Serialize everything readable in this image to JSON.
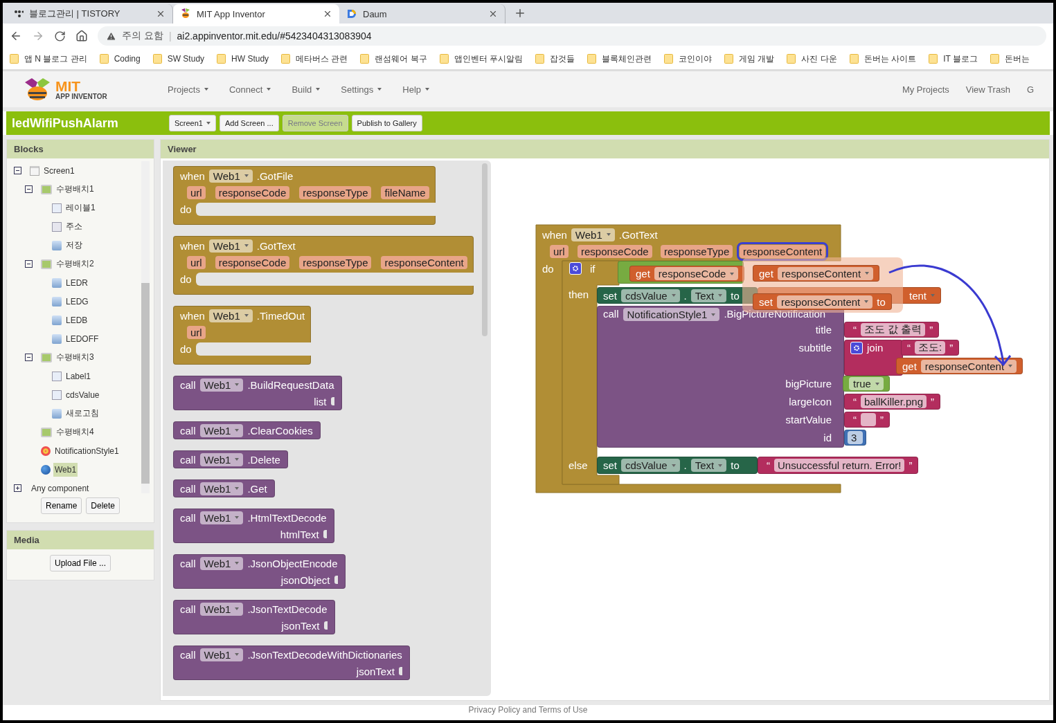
{
  "browser": {
    "tabs": [
      {
        "title": "블로그관리 | TISTORY",
        "selected": false
      },
      {
        "title": "MIT App Inventor",
        "selected": true
      },
      {
        "title": "Daum",
        "selected": false
      }
    ],
    "address": {
      "warning": "주의 요함",
      "separator": "|",
      "url": "ai2.appinventor.mit.edu/#5423404313083904"
    },
    "bookmarks": [
      "앱 N 블로그 관리",
      "Coding",
      "SW Study",
      "HW Study",
      "메타버스 관련",
      "랜섬웨어 복구",
      "앱인벤터 푸시알림",
      "잡것들",
      "블록체인관련",
      "코인이야",
      "게임 개발",
      "사진 다운",
      "돈버는 사이트",
      "IT 블로그",
      "돈버는"
    ]
  },
  "app_header": {
    "logo": {
      "line1": "MIT",
      "line2": "APP INVENTOR"
    },
    "menu": [
      "Projects",
      "Connect",
      "Build",
      "Settings",
      "Help"
    ],
    "links": [
      "My Projects",
      "View Trash",
      "G"
    ]
  },
  "project_bar": {
    "title": "ledWifiPushAlarm",
    "buttons": [
      {
        "label": "Screen1",
        "dropdown": true,
        "disabled": false
      },
      {
        "label": "Add Screen ...",
        "dropdown": false,
        "disabled": false
      },
      {
        "label": "Remove Screen",
        "dropdown": false,
        "disabled": true
      },
      {
        "label": "Publish to Gallery",
        "dropdown": false,
        "disabled": false
      }
    ]
  },
  "blocks_panel": {
    "title": "Blocks",
    "tree": [
      {
        "label": "Screen1",
        "kind": "screen",
        "expanded": true,
        "selected": false,
        "children": [
          {
            "label": "수평배치1",
            "kind": "arrangement",
            "expanded": true,
            "selected": false,
            "children": [
              {
                "label": "레이블1",
                "kind": "label",
                "selected": false
              },
              {
                "label": "주소",
                "kind": "textbox",
                "selected": false
              },
              {
                "label": "저장",
                "kind": "button",
                "selected": false
              }
            ]
          },
          {
            "label": "수평배치2",
            "kind": "arrangement",
            "expanded": true,
            "selected": false,
            "children": [
              {
                "label": "LEDR",
                "kind": "button",
                "selected": false
              },
              {
                "label": "LEDG",
                "kind": "button",
                "selected": false
              },
              {
                "label": "LEDB",
                "kind": "button",
                "selected": false
              },
              {
                "label": "LEDOFF",
                "kind": "button",
                "selected": false
              }
            ]
          },
          {
            "label": "수평배치3",
            "kind": "arrangement",
            "expanded": true,
            "selected": false,
            "children": [
              {
                "label": "Label1",
                "kind": "label",
                "selected": false
              },
              {
                "label": "cdsValue",
                "kind": "label",
                "selected": false
              },
              {
                "label": "새로고침",
                "kind": "button",
                "selected": false
              }
            ]
          },
          {
            "label": "수평배치4",
            "kind": "arrangement",
            "selected": false
          },
          {
            "label": "NotificationStyle1",
            "kind": "notifier",
            "selected": false
          },
          {
            "label": "Web1",
            "kind": "web",
            "selected": true
          }
        ]
      },
      {
        "label": "Any component",
        "expanded": false,
        "selected": false
      }
    ],
    "buttons": [
      "Rename",
      "Delete"
    ]
  },
  "media_panel": {
    "title": "Media",
    "button": "Upload File ..."
  },
  "viewer": {
    "title": "Viewer",
    "flyout": [
      {
        "kind": "event",
        "verb": "when",
        "component": "Web1",
        "name": ".GotFile",
        "params": [
          "url",
          "responseCode",
          "responseType",
          "fileName"
        ],
        "do": "do"
      },
      {
        "kind": "event",
        "verb": "when",
        "component": "Web1",
        "name": ".GotText",
        "params": [
          "url",
          "responseCode",
          "responseType",
          "responseContent"
        ],
        "do": "do"
      },
      {
        "kind": "event",
        "verb": "when",
        "component": "Web1",
        "name": ".TimedOut",
        "params": [
          "url"
        ],
        "do": "do"
      },
      {
        "kind": "method",
        "verb": "call",
        "component": "Web1",
        "name": ".BuildRequestData",
        "args": [
          "list"
        ]
      },
      {
        "kind": "method",
        "verb": "call",
        "component": "Web1",
        "name": ".ClearCookies"
      },
      {
        "kind": "method",
        "verb": "call",
        "component": "Web1",
        "name": ".Delete"
      },
      {
        "kind": "method",
        "verb": "call",
        "component": "Web1",
        "name": ".Get"
      },
      {
        "kind": "method",
        "verb": "call",
        "component": "Web1",
        "name": ".HtmlTextDecode",
        "args": [
          "htmlText"
        ]
      },
      {
        "kind": "method",
        "verb": "call",
        "component": "Web1",
        "name": ".JsonObjectEncode",
        "args": [
          "jsonObject"
        ]
      },
      {
        "kind": "method",
        "verb": "call",
        "component": "Web1",
        "name": ".JsonTextDecode",
        "args": [
          "jsonText"
        ]
      },
      {
        "kind": "method",
        "verb": "call",
        "component": "Web1",
        "name": ".JsonTextDecodeWithDictionaries",
        "args": [
          "jsonText"
        ]
      }
    ],
    "workspace": {
      "event": {
        "verb": "when",
        "component": "Web1",
        "name": ".GotText",
        "do": "do",
        "params": [
          {
            "name": "url",
            "highlighted": false
          },
          {
            "name": "responseCode",
            "highlighted": false
          },
          {
            "name": "responseType",
            "highlighted": false
          },
          {
            "name": "responseContent",
            "highlighted": true
          }
        ]
      },
      "if": {
        "keyword": "if",
        "then": "then",
        "else": "else"
      },
      "condition": {
        "verb": "get",
        "variable": "responseCode"
      },
      "then_set": {
        "verb": "set",
        "component": "cdsValue",
        "dot": ".",
        "property": "Text",
        "to": "to"
      },
      "hidden_get": {
        "fragment": "tent"
      },
      "call": {
        "verb": "call",
        "component": "NotificationStyle1",
        "method": ".BigPictureNotification"
      },
      "args": [
        {
          "label": "title",
          "kind": "text",
          "open": "“",
          "value": "조도 값 출력",
          "close": "”"
        },
        {
          "label": "subtitle",
          "kind": "join",
          "keyword": "join",
          "open": "“",
          "value": "조도:",
          "close": "”",
          "get": "get",
          "variable": "responseContent"
        },
        {
          "label": "bigPicture",
          "kind": "logic",
          "value": "true"
        },
        {
          "label": "largeIcon",
          "kind": "text",
          "open": "“",
          "value": "ballKiller.png",
          "close": "”"
        },
        {
          "label": "startValue",
          "kind": "text",
          "open": "“",
          "close": "”"
        },
        {
          "label": "id",
          "kind": "number",
          "value": "3"
        }
      ],
      "else_set": {
        "verb": "set",
        "component": "cdsValue",
        "dot": ".",
        "property": "Text",
        "to": "to",
        "open": "“",
        "value": "Unsuccessful return. Error!",
        "close": "”"
      },
      "dragged": {
        "get": {
          "verb": "get",
          "variable": "responseContent"
        },
        "set": {
          "verb": "set",
          "variable": "responseContent",
          "to": "to"
        }
      }
    }
  },
  "footer": {
    "text": "Privacy Policy and Terms of Use"
  }
}
